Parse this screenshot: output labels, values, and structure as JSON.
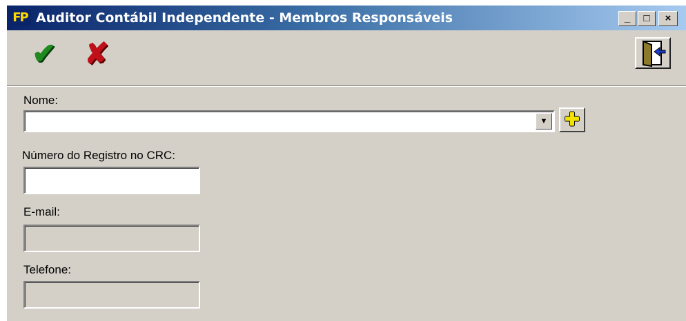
{
  "window": {
    "app_icon": "FP",
    "title": "Auditor Contábil Independente - Membros Responsáveis",
    "minimize_icon": "minimize-icon",
    "maximize_icon": "maximize-icon",
    "close_icon": "close-icon"
  },
  "toolbar": {
    "confirm_icon": "checkmark-icon",
    "cancel_icon": "x-icon",
    "exit_icon": "exit-door-icon"
  },
  "form": {
    "nome": {
      "label": "Nome:",
      "value": ""
    },
    "crc": {
      "label": "Número do Registro no CRC:",
      "value": ""
    },
    "email": {
      "label": "E-mail:",
      "value": ""
    },
    "telefone": {
      "label": "Telefone:",
      "value": ""
    },
    "add_icon": "plus-icon"
  },
  "glyphs": {
    "check": "✔",
    "cross": "✘",
    "plus": "✚",
    "dropdown": "▼",
    "min": "_",
    "max": "□",
    "close": "×"
  }
}
